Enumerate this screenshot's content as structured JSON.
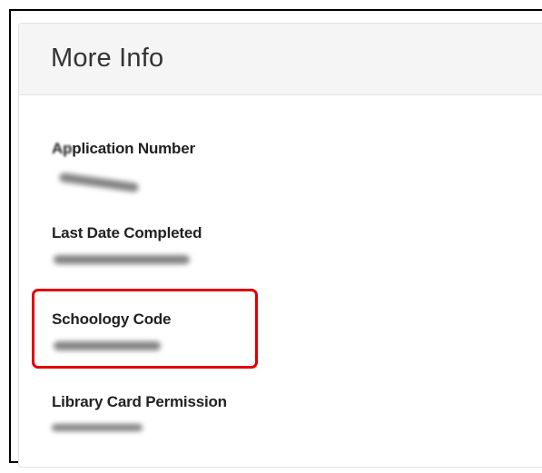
{
  "panel": {
    "title": "More Info",
    "fields": [
      {
        "label_blurred": "Ap",
        "label_rest": "plication Number"
      },
      {
        "label": "Last Date Completed"
      },
      {
        "label": "Schoology Code"
      },
      {
        "label": "Library Card Permission"
      }
    ]
  },
  "colors": {
    "highlight": "#e00000",
    "header_bg": "#f5f5f5"
  }
}
